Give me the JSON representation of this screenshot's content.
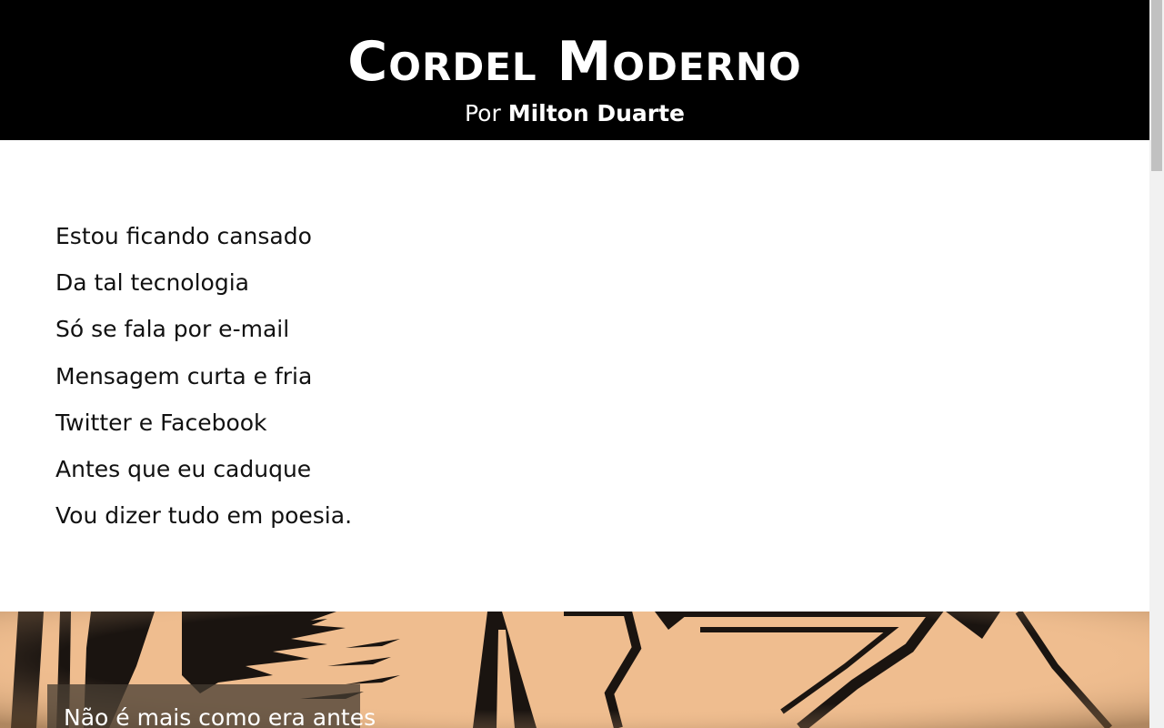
{
  "header": {
    "title": "Cordel Moderno",
    "byline_prefix": "Por",
    "author": "Milton Duarte"
  },
  "poem": {
    "stanza1": [
      "Estou ficando cansado",
      "Da tal tecnologia",
      "Só se fala por e-mail",
      "Mensagem curta e fria",
      "Twitter e Facebook",
      "Antes que eu caduque",
      "Vou dizer tudo em poesia."
    ],
    "stanza2_first_line": "Não é mais como era antes"
  },
  "colors": {
    "header_bg": "#000000",
    "art_bg": "#efbd8f"
  }
}
